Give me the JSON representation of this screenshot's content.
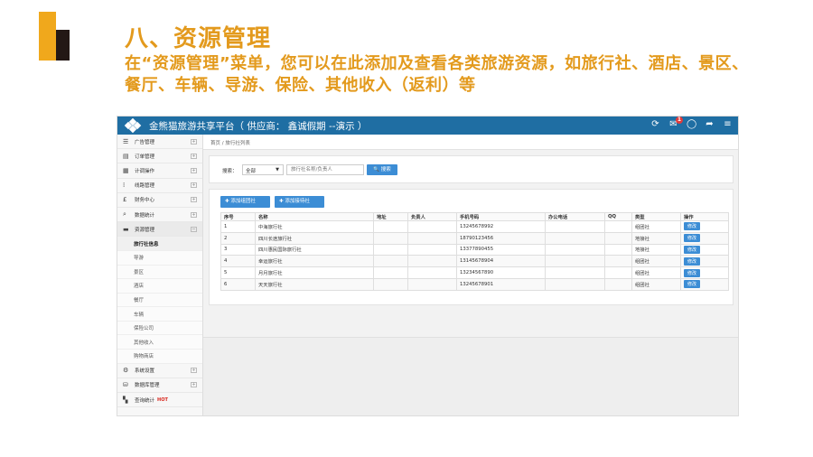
{
  "slide": {
    "title": "八、资源管理",
    "description": "在“资源管理”菜单，您可以在此添加及查看各类旅游资源，如旅行社、酒店、景区、餐厅、车辆、导游、保险、其他收入（返利）等"
  },
  "app": {
    "title": "金熊猫旅游共享平台（ 供应商： 鑫诚假期 --演示 ）",
    "notification_count": "1",
    "brand_color": "#1f6ea3",
    "accent_color": "#3c8dd5"
  },
  "sidebar": {
    "items": [
      {
        "label": "广告管理",
        "icon": "list-icon"
      },
      {
        "label": "订单管理",
        "icon": "doc-icon"
      },
      {
        "label": "计调操作",
        "icon": "calendar-icon"
      },
      {
        "label": "线路管理",
        "icon": "route-icon"
      },
      {
        "label": "财务中心",
        "icon": "pound-icon"
      },
      {
        "label": "数据统计",
        "icon": "search-icon"
      },
      {
        "label": "资源管理",
        "icon": "stack-icon"
      }
    ],
    "submenu": [
      "旅行社信息",
      "导游",
      "景区",
      "酒店",
      "餐厅",
      "车辆",
      "保险公司",
      "其他收入",
      "购物商店"
    ],
    "bottom_items": [
      {
        "label": "系统设置",
        "icon": "gear-icon"
      },
      {
        "label": "数据库管理",
        "icon": "database-icon"
      },
      {
        "label": "查询统计",
        "icon": "grid-icon",
        "badge": "HOT"
      }
    ]
  },
  "breadcrumb": {
    "home": "首页",
    "current": "旅行社列表"
  },
  "search": {
    "label": "搜索：",
    "select_value": "全部",
    "placeholder": "旅行社名称/负责人",
    "button": "搜索"
  },
  "actions": {
    "add_group": "添加组团社",
    "add_local": "添加接待社"
  },
  "chart_data": {
    "type": "table",
    "columns": [
      "序号",
      "名称",
      "地址",
      "负责人",
      "手机号码",
      "办公电话",
      "QQ",
      "类型",
      "操作"
    ],
    "rows": [
      {
        "no": "1",
        "name": "中海旅行社",
        "address": "",
        "person": "",
        "mobile": "13245678992",
        "office": "",
        "qq": "",
        "type": "组团社",
        "action": "修改"
      },
      {
        "no": "2",
        "name": "四川长途旅行社",
        "address": "",
        "person": "",
        "mobile": "18790123456",
        "office": "",
        "qq": "",
        "type": "地接社",
        "action": "修改"
      },
      {
        "no": "3",
        "name": "四川惠民国际旅行社",
        "address": "",
        "person": "",
        "mobile": "13377890455",
        "office": "",
        "qq": "",
        "type": "地接社",
        "action": "修改"
      },
      {
        "no": "4",
        "name": "幸运旅行社",
        "address": "",
        "person": "",
        "mobile": "13145678904",
        "office": "",
        "qq": "",
        "type": "组团社",
        "action": "修改"
      },
      {
        "no": "5",
        "name": "月月旅行社",
        "address": "",
        "person": "",
        "mobile": "13234567890",
        "office": "",
        "qq": "",
        "type": "组团社",
        "action": "修改"
      },
      {
        "no": "6",
        "name": "天天旅行社",
        "address": "",
        "person": "",
        "mobile": "13245678901",
        "office": "",
        "qq": "",
        "type": "组团社",
        "action": "修改"
      }
    ]
  }
}
